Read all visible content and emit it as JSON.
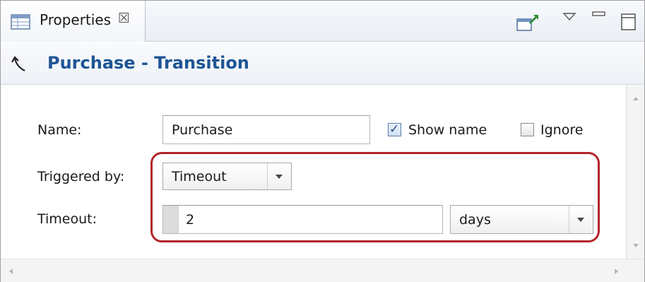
{
  "tab": {
    "label": "Properties",
    "close_glyph": "☒",
    "icon": "properties-table-icon"
  },
  "toolbar": {
    "icons": [
      "pin-editor-icon",
      "view-menu-icon",
      "minimize-icon",
      "maximize-icon"
    ]
  },
  "header": {
    "icon": "transition-arrow-icon",
    "title": "Purchase - Transition"
  },
  "form": {
    "name_label": "Name:",
    "name_value": "Purchase",
    "show_name_label": "Show name",
    "show_name_checked": true,
    "ignore_label": "Ignore",
    "ignore_checked": false,
    "triggered_label": "Triggered by:",
    "triggered_value": "Timeout",
    "timeout_label": "Timeout:",
    "timeout_value": "2",
    "timeout_unit": "days"
  },
  "colors": {
    "title": "#1e5595",
    "highlight": "#b3252b"
  }
}
